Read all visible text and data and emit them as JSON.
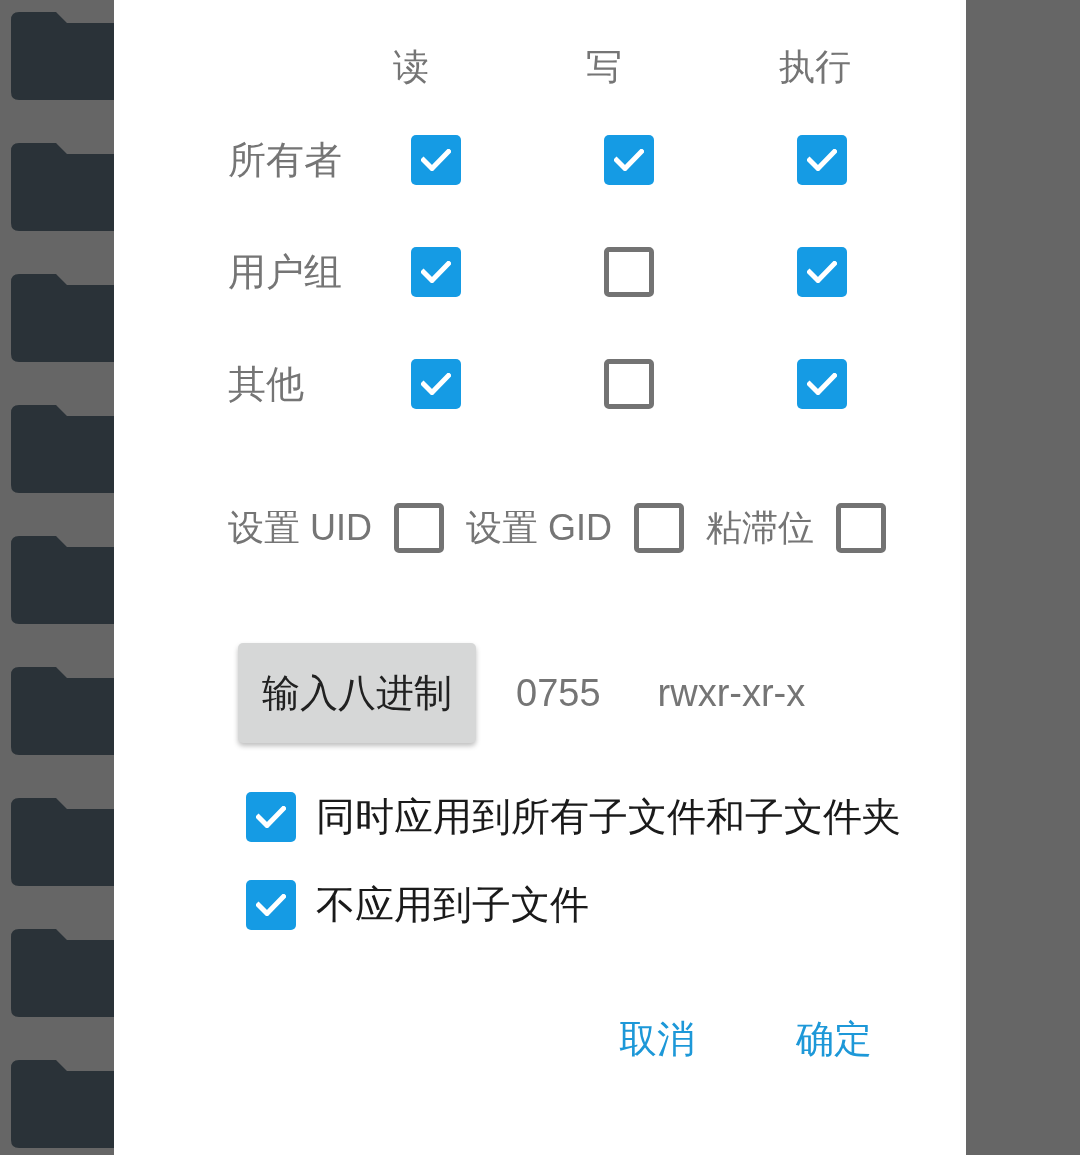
{
  "permission_table": {
    "columns": [
      "读",
      "写",
      "执行"
    ],
    "rows": [
      {
        "label": "所有者",
        "cells": [
          {
            "checked": true
          },
          {
            "checked": true
          },
          {
            "checked": true
          }
        ]
      },
      {
        "label": "用户组",
        "cells": [
          {
            "checked": true
          },
          {
            "checked": false
          },
          {
            "checked": true
          }
        ]
      },
      {
        "label": "其他",
        "cells": [
          {
            "checked": true
          },
          {
            "checked": false
          },
          {
            "checked": true
          }
        ]
      }
    ]
  },
  "special_bits": [
    {
      "label": "设置 UID",
      "checked": false
    },
    {
      "label": "设置 GID",
      "checked": false
    },
    {
      "label": "粘滞位",
      "checked": false
    }
  ],
  "octal": {
    "button": "输入八进制",
    "value": "0755",
    "symbolic": "rwxr-xr-x"
  },
  "options": [
    {
      "label": "同时应用到所有子文件和子文件夹",
      "checked": true
    },
    {
      "label": "不应用到子文件",
      "checked": true
    }
  ],
  "actions": [
    {
      "label": "取消"
    },
    {
      "label": "确定"
    }
  ]
}
